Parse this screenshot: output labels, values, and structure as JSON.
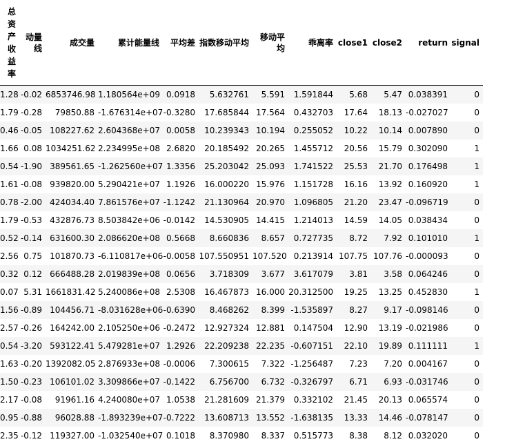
{
  "table": {
    "columns": [
      "总资产收益率",
      "动量线",
      "成交量",
      "累计能量线",
      "平均差",
      "指数移动平均",
      "移动平均",
      "乖离率",
      "close1",
      "close2",
      "return",
      "signal"
    ],
    "rows": [
      [
        "1.28",
        "-0.02",
        "6853746.98",
        "1.180564e+09",
        "0.0918",
        "5.632761",
        "5.591",
        "1.591844",
        "5.68",
        "5.47",
        "0.038391",
        "0"
      ],
      [
        "1.79",
        "-0.28",
        "79850.88",
        "-1.676314e+07",
        "-0.3280",
        "17.685844",
        "17.564",
        "0.432703",
        "17.64",
        "18.13",
        "-0.027027",
        "0"
      ],
      [
        "0.46",
        "-0.05",
        "108227.62",
        "2.604368e+07",
        "0.0058",
        "10.239343",
        "10.194",
        "0.255052",
        "10.22",
        "10.14",
        "0.007890",
        "0"
      ],
      [
        "1.66",
        "0.08",
        "1034251.62",
        "2.234995e+08",
        "2.6820",
        "20.185492",
        "20.265",
        "1.455712",
        "20.56",
        "15.79",
        "0.302090",
        "1"
      ],
      [
        "0.54",
        "-1.90",
        "389561.65",
        "-1.262560e+07",
        "1.3356",
        "25.203042",
        "25.093",
        "1.741522",
        "25.53",
        "21.70",
        "0.176498",
        "1"
      ],
      [
        "1.61",
        "-0.08",
        "939820.00",
        "5.290421e+07",
        "1.1926",
        "16.000220",
        "15.976",
        "1.151728",
        "16.16",
        "13.92",
        "0.160920",
        "1"
      ],
      [
        "0.78",
        "-2.00",
        "424034.40",
        "7.861576e+07",
        "-1.1242",
        "21.130964",
        "20.970",
        "1.096805",
        "21.20",
        "23.47",
        "-0.096719",
        "0"
      ],
      [
        "1.79",
        "-0.53",
        "432876.73",
        "8.503842e+06",
        "-0.0142",
        "14.530905",
        "14.415",
        "1.214013",
        "14.59",
        "14.05",
        "0.038434",
        "0"
      ],
      [
        "0.52",
        "-0.14",
        "631600.30",
        "2.086620e+08",
        "0.5668",
        "8.660836",
        "8.657",
        "0.727735",
        "8.72",
        "7.92",
        "0.101010",
        "1"
      ],
      [
        "2.56",
        "0.75",
        "101870.73",
        "-6.110817e+06",
        "-0.0058",
        "107.550951",
        "107.520",
        "0.213914",
        "107.75",
        "107.76",
        "-0.000093",
        "0"
      ],
      [
        "0.32",
        "0.12",
        "666488.28",
        "2.019839e+08",
        "0.0656",
        "3.718309",
        "3.677",
        "3.617079",
        "3.81",
        "3.58",
        "0.064246",
        "0"
      ],
      [
        "0.07",
        "5.31",
        "1661831.42",
        "5.240086e+08",
        "2.5308",
        "16.467873",
        "16.000",
        "20.312500",
        "19.25",
        "13.25",
        "0.452830",
        "1"
      ],
      [
        "1.56",
        "-0.89",
        "104456.71",
        "-8.031628e+06",
        "-0.6390",
        "8.468262",
        "8.399",
        "-1.535897",
        "8.27",
        "9.17",
        "-0.098146",
        "0"
      ],
      [
        "2.57",
        "-0.26",
        "164242.00",
        "2.105250e+06",
        "-0.2472",
        "12.927324",
        "12.881",
        "0.147504",
        "12.90",
        "13.19",
        "-0.021986",
        "0"
      ],
      [
        "0.54",
        "-3.20",
        "593122.41",
        "5.479281e+07",
        "1.2926",
        "22.209238",
        "22.235",
        "-0.607151",
        "22.10",
        "19.89",
        "0.111111",
        "1"
      ],
      [
        "1.63",
        "-0.20",
        "1392082.05",
        "2.876933e+08",
        "-0.0006",
        "7.300615",
        "7.322",
        "-1.256487",
        "7.23",
        "7.20",
        "0.004167",
        "0"
      ],
      [
        "1.50",
        "-0.23",
        "106101.02",
        "3.309866e+07",
        "-0.1422",
        "6.756700",
        "6.732",
        "-0.326797",
        "6.71",
        "6.93",
        "-0.031746",
        "0"
      ],
      [
        "2.17",
        "-0.08",
        "91961.16",
        "4.240080e+07",
        "1.0538",
        "21.281609",
        "21.379",
        "0.332102",
        "21.45",
        "20.13",
        "0.065574",
        "0"
      ],
      [
        "0.95",
        "-0.88",
        "96028.88",
        "-1.893239e+07",
        "-0.7222",
        "13.608713",
        "13.552",
        "-1.638135",
        "13.33",
        "14.46",
        "-0.078147",
        "0"
      ],
      [
        "2.35",
        "-0.12",
        "119327.00",
        "-1.032540e+07",
        "0.1018",
        "8.370980",
        "8.337",
        "0.515773",
        "8.38",
        "8.12",
        "0.032020",
        "0"
      ]
    ]
  }
}
